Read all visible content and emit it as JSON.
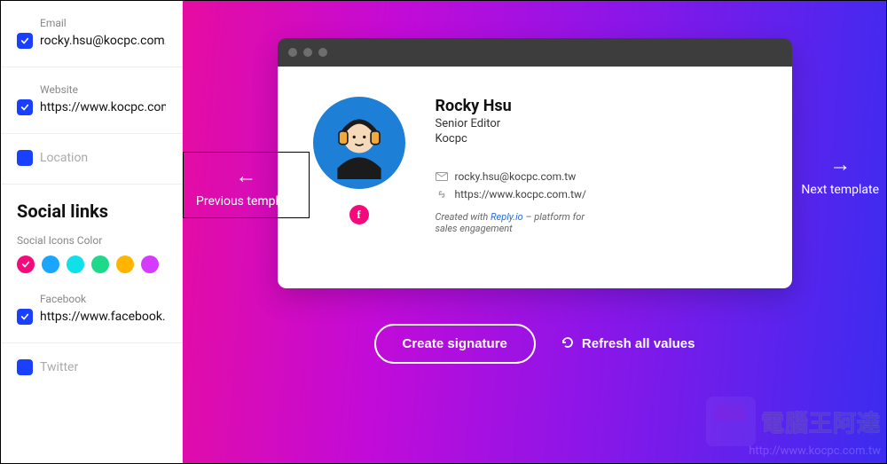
{
  "sidebar": {
    "email": {
      "label": "Email",
      "value": "rocky.hsu@kocpc.com.t",
      "checked": true
    },
    "website": {
      "label": "Website",
      "value": "https://www.kocpc.com.",
      "checked": true
    },
    "location": {
      "label": "Location",
      "value": "",
      "checked": false
    },
    "social_section": "Social links",
    "color_label": "Social Icons Color",
    "colors": [
      "#f40a7a",
      "#1aa6ff",
      "#10e0e8",
      "#1ed98a",
      "#ffb400",
      "#d63aff"
    ],
    "selected_color_index": 0,
    "facebook": {
      "label": "Facebook",
      "value": "https://www.facebook.c",
      "checked": true
    },
    "twitter": {
      "label": "Twitter",
      "value": "",
      "checked": false
    }
  },
  "nav": {
    "prev": "Previous template",
    "next": "Next template"
  },
  "preview": {
    "name": "Rocky Hsu",
    "role": "Senior Editor",
    "company": "Kocpc",
    "email": "rocky.hsu@kocpc.com.tw",
    "website": "https://www.kocpc.com.tw/",
    "credit_prefix": "Created with ",
    "credit_link": "Reply.io",
    "credit_suffix": " – platform for sales engagement",
    "facebook_letter": "f"
  },
  "actions": {
    "create": "Create signature",
    "refresh": "Refresh all values"
  },
  "watermark": {
    "text": "電腦王阿達",
    "url": "http://www.kocpc.com.tw"
  }
}
